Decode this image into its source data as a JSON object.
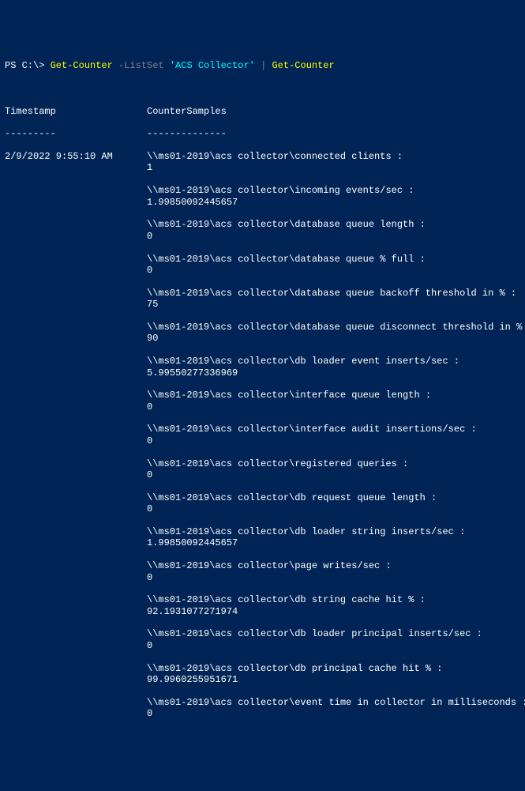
{
  "prompt": {
    "ps": "PS C:\\> ",
    "cmd1": "Get-Counter",
    "param1": " -ListSet ",
    "str1": "'ACS Collector'",
    "pipe": " | ",
    "cmd2": "Get-Counter"
  },
  "headers": {
    "timestamp": "Timestamp",
    "samples": "CounterSamples",
    "tsep": "---------",
    "ssep": "--------------"
  },
  "timestamp": "2/9/2022 9:55:10 AM",
  "entries": [
    {
      "path": "\\\\ms01-2019\\acs collector\\connected clients :",
      "value": "1"
    },
    {
      "path": "\\\\ms01-2019\\acs collector\\incoming events/sec :",
      "value": "1.99850092445657"
    },
    {
      "path": "\\\\ms01-2019\\acs collector\\database queue length :",
      "value": "0"
    },
    {
      "path": "\\\\ms01-2019\\acs collector\\database queue % full :",
      "value": "0"
    },
    {
      "path": "\\\\ms01-2019\\acs collector\\database queue backoff threshold in % :",
      "value": "75"
    },
    {
      "path": "\\\\ms01-2019\\acs collector\\database queue disconnect threshold in % :",
      "value": "90"
    },
    {
      "path": "\\\\ms01-2019\\acs collector\\db loader event inserts/sec :",
      "value": "5.99550277336969"
    },
    {
      "path": "\\\\ms01-2019\\acs collector\\interface queue length :",
      "value": "0"
    },
    {
      "path": "\\\\ms01-2019\\acs collector\\interface audit insertions/sec :",
      "value": "0"
    },
    {
      "path": "\\\\ms01-2019\\acs collector\\registered queries :",
      "value": "0"
    },
    {
      "path": "\\\\ms01-2019\\acs collector\\db request queue length :",
      "value": "0"
    },
    {
      "path": "\\\\ms01-2019\\acs collector\\db loader string inserts/sec :",
      "value": "1.99850092445657"
    },
    {
      "path": "\\\\ms01-2019\\acs collector\\page writes/sec :",
      "value": "0"
    },
    {
      "path": "\\\\ms01-2019\\acs collector\\db string cache hit % :",
      "value": "92.1931077271974"
    },
    {
      "path": "\\\\ms01-2019\\acs collector\\db loader principal inserts/sec :",
      "value": "0"
    },
    {
      "path": "\\\\ms01-2019\\acs collector\\db principal cache hit % :",
      "value": "99.9960255951671"
    },
    {
      "path": "\\\\ms01-2019\\acs collector\\event time in collector in milliseconds :",
      "value": "0"
    }
  ]
}
